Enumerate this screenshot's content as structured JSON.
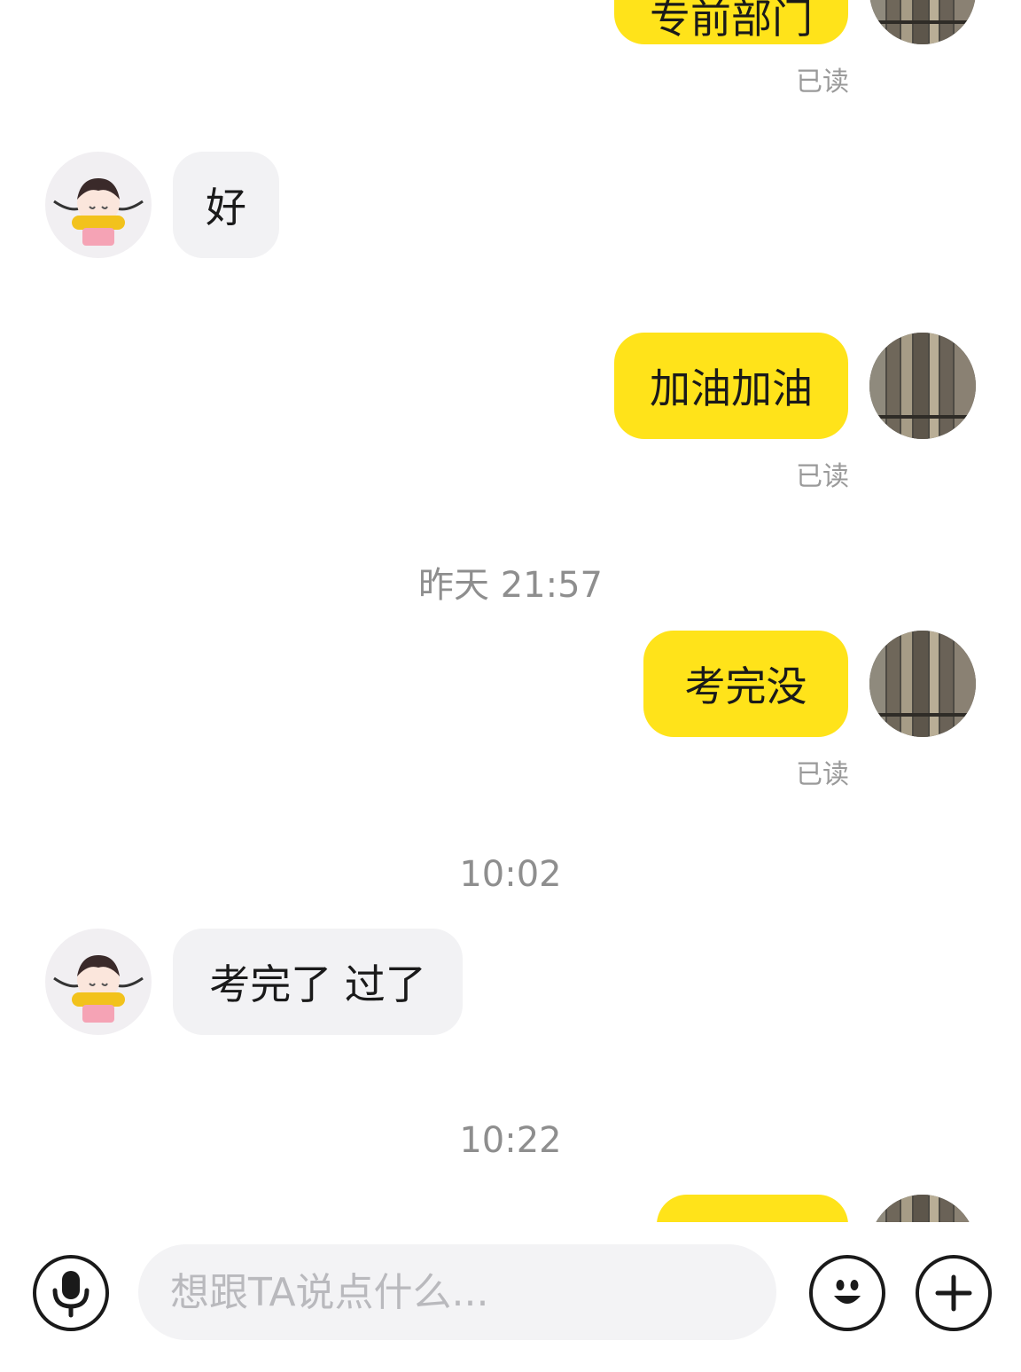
{
  "messages": [
    {
      "side": "out",
      "text": "专前部门"
    },
    {
      "side": "out_read",
      "text": "已读"
    },
    {
      "side": "in",
      "text": "好"
    },
    {
      "side": "out",
      "text": "加油加油"
    },
    {
      "side": "out_read",
      "text": "已读"
    },
    {
      "side": "time",
      "text": "昨天 21:57"
    },
    {
      "side": "out",
      "text": "考完没"
    },
    {
      "side": "out_read",
      "text": "已读"
    },
    {
      "side": "time",
      "text": "10:02"
    },
    {
      "side": "in",
      "text": "考完了 过了"
    },
    {
      "side": "time",
      "text": "10:22"
    }
  ],
  "input": {
    "placeholder": "想跟TA说点什么..."
  },
  "icons": {
    "voice": "microphone-icon",
    "emoji": "smiley-icon",
    "more": "plus-icon"
  },
  "colors": {
    "outgoing_bubble": "#ffe31a",
    "incoming_bubble": "#f2f2f4",
    "read_text": "#9a9a9a"
  }
}
